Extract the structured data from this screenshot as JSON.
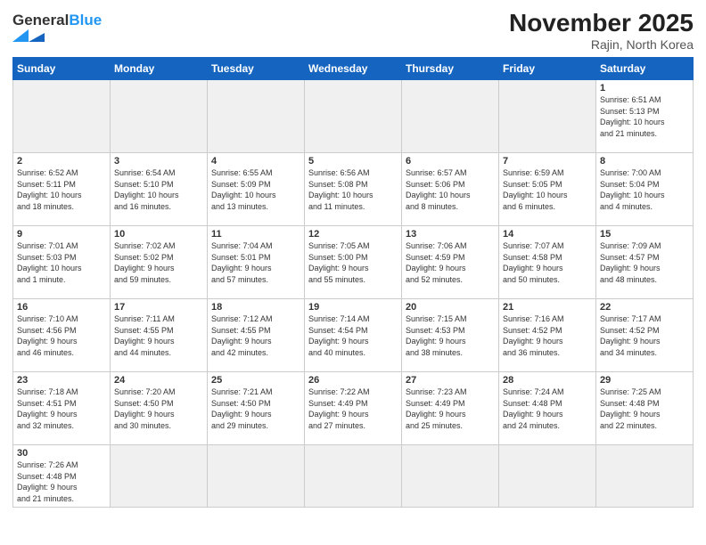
{
  "header": {
    "logo_general": "General",
    "logo_blue": "Blue",
    "month_title": "November 2025",
    "location": "Rajin, North Korea"
  },
  "days_of_week": [
    "Sunday",
    "Monday",
    "Tuesday",
    "Wednesday",
    "Thursday",
    "Friday",
    "Saturday"
  ],
  "rows": [
    [
      {
        "day": "",
        "empty": true
      },
      {
        "day": "",
        "empty": true
      },
      {
        "day": "",
        "empty": true
      },
      {
        "day": "",
        "empty": true
      },
      {
        "day": "",
        "empty": true
      },
      {
        "day": "",
        "empty": true
      },
      {
        "day": "1",
        "info": "Sunrise: 6:51 AM\nSunset: 5:13 PM\nDaylight: 10 hours\nand 21 minutes."
      }
    ],
    [
      {
        "day": "2",
        "info": "Sunrise: 6:52 AM\nSunset: 5:11 PM\nDaylight: 10 hours\nand 18 minutes."
      },
      {
        "day": "3",
        "info": "Sunrise: 6:54 AM\nSunset: 5:10 PM\nDaylight: 10 hours\nand 16 minutes."
      },
      {
        "day": "4",
        "info": "Sunrise: 6:55 AM\nSunset: 5:09 PM\nDaylight: 10 hours\nand 13 minutes."
      },
      {
        "day": "5",
        "info": "Sunrise: 6:56 AM\nSunset: 5:08 PM\nDaylight: 10 hours\nand 11 minutes."
      },
      {
        "day": "6",
        "info": "Sunrise: 6:57 AM\nSunset: 5:06 PM\nDaylight: 10 hours\nand 8 minutes."
      },
      {
        "day": "7",
        "info": "Sunrise: 6:59 AM\nSunset: 5:05 PM\nDaylight: 10 hours\nand 6 minutes."
      },
      {
        "day": "8",
        "info": "Sunrise: 7:00 AM\nSunset: 5:04 PM\nDaylight: 10 hours\nand 4 minutes."
      }
    ],
    [
      {
        "day": "9",
        "info": "Sunrise: 7:01 AM\nSunset: 5:03 PM\nDaylight: 10 hours\nand 1 minute."
      },
      {
        "day": "10",
        "info": "Sunrise: 7:02 AM\nSunset: 5:02 PM\nDaylight: 9 hours\nand 59 minutes."
      },
      {
        "day": "11",
        "info": "Sunrise: 7:04 AM\nSunset: 5:01 PM\nDaylight: 9 hours\nand 57 minutes."
      },
      {
        "day": "12",
        "info": "Sunrise: 7:05 AM\nSunset: 5:00 PM\nDaylight: 9 hours\nand 55 minutes."
      },
      {
        "day": "13",
        "info": "Sunrise: 7:06 AM\nSunset: 4:59 PM\nDaylight: 9 hours\nand 52 minutes."
      },
      {
        "day": "14",
        "info": "Sunrise: 7:07 AM\nSunset: 4:58 PM\nDaylight: 9 hours\nand 50 minutes."
      },
      {
        "day": "15",
        "info": "Sunrise: 7:09 AM\nSunset: 4:57 PM\nDaylight: 9 hours\nand 48 minutes."
      }
    ],
    [
      {
        "day": "16",
        "info": "Sunrise: 7:10 AM\nSunset: 4:56 PM\nDaylight: 9 hours\nand 46 minutes."
      },
      {
        "day": "17",
        "info": "Sunrise: 7:11 AM\nSunset: 4:55 PM\nDaylight: 9 hours\nand 44 minutes."
      },
      {
        "day": "18",
        "info": "Sunrise: 7:12 AM\nSunset: 4:55 PM\nDaylight: 9 hours\nand 42 minutes."
      },
      {
        "day": "19",
        "info": "Sunrise: 7:14 AM\nSunset: 4:54 PM\nDaylight: 9 hours\nand 40 minutes."
      },
      {
        "day": "20",
        "info": "Sunrise: 7:15 AM\nSunset: 4:53 PM\nDaylight: 9 hours\nand 38 minutes."
      },
      {
        "day": "21",
        "info": "Sunrise: 7:16 AM\nSunset: 4:52 PM\nDaylight: 9 hours\nand 36 minutes."
      },
      {
        "day": "22",
        "info": "Sunrise: 7:17 AM\nSunset: 4:52 PM\nDaylight: 9 hours\nand 34 minutes."
      }
    ],
    [
      {
        "day": "23",
        "info": "Sunrise: 7:18 AM\nSunset: 4:51 PM\nDaylight: 9 hours\nand 32 minutes."
      },
      {
        "day": "24",
        "info": "Sunrise: 7:20 AM\nSunset: 4:50 PM\nDaylight: 9 hours\nand 30 minutes."
      },
      {
        "day": "25",
        "info": "Sunrise: 7:21 AM\nSunset: 4:50 PM\nDaylight: 9 hours\nand 29 minutes."
      },
      {
        "day": "26",
        "info": "Sunrise: 7:22 AM\nSunset: 4:49 PM\nDaylight: 9 hours\nand 27 minutes."
      },
      {
        "day": "27",
        "info": "Sunrise: 7:23 AM\nSunset: 4:49 PM\nDaylight: 9 hours\nand 25 minutes."
      },
      {
        "day": "28",
        "info": "Sunrise: 7:24 AM\nSunset: 4:48 PM\nDaylight: 9 hours\nand 24 minutes."
      },
      {
        "day": "29",
        "info": "Sunrise: 7:25 AM\nSunset: 4:48 PM\nDaylight: 9 hours\nand 22 minutes."
      }
    ],
    [
      {
        "day": "30",
        "info": "Sunrise: 7:26 AM\nSunset: 4:48 PM\nDaylight: 9 hours\nand 21 minutes.",
        "last": true
      },
      {
        "day": "",
        "empty": true,
        "last": true
      },
      {
        "day": "",
        "empty": true,
        "last": true
      },
      {
        "day": "",
        "empty": true,
        "last": true
      },
      {
        "day": "",
        "empty": true,
        "last": true
      },
      {
        "day": "",
        "empty": true,
        "last": true
      },
      {
        "day": "",
        "empty": true,
        "last": true
      }
    ]
  ]
}
